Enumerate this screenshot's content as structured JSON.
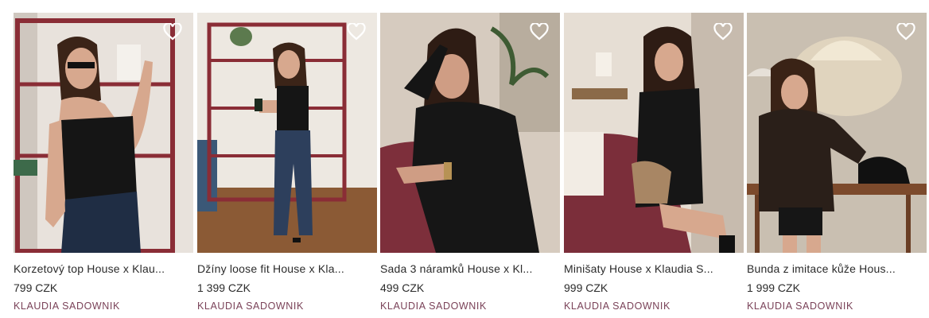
{
  "products": [
    {
      "title": "Korzetový top House x Klau...",
      "price": "799 CZK",
      "brand": "KLAUDIA SADOWNIK"
    },
    {
      "title": "Džíny loose fit House x Kla...",
      "price": "1 399 CZK",
      "brand": "KLAUDIA SADOWNIK"
    },
    {
      "title": "Sada 3 náramků House x Kl...",
      "price": "499 CZK",
      "brand": "KLAUDIA SADOWNIK"
    },
    {
      "title": "Minišaty House x Klaudia S...",
      "price": "999 CZK",
      "brand": "KLAUDIA SADOWNIK"
    },
    {
      "title": "Bunda z imitace kůže Hous...",
      "price": "1 999 CZK",
      "brand": "KLAUDIA SADOWNIK"
    }
  ],
  "icons": {
    "favorite": "heart-outline-icon"
  },
  "colors": {
    "brand_text": "#7a4258",
    "text": "#2b2b2b"
  }
}
